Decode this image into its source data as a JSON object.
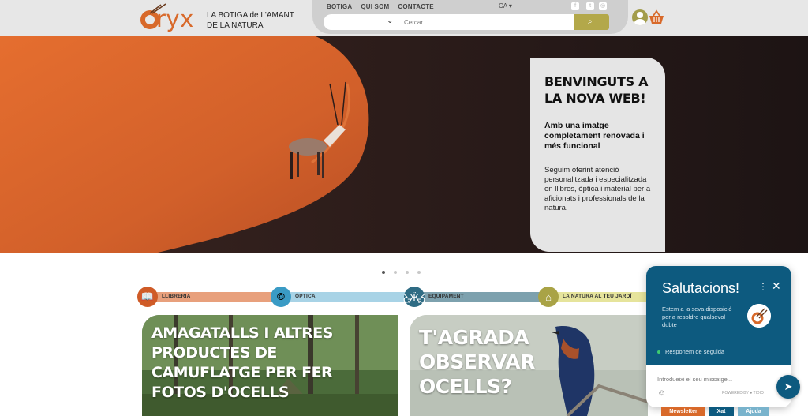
{
  "brand": {
    "logo_text": "ryx",
    "tagline": "LA BOTIGA de L'AMANT DE LA NATURA"
  },
  "nav": {
    "links": [
      "BOTIGA",
      "QUI SOM",
      "CONTACTE"
    ],
    "language": "CA",
    "social_icons": [
      "facebook-icon",
      "twitter-icon",
      "instagram-icon"
    ]
  },
  "search": {
    "placeholder": "Cercar"
  },
  "hero": {
    "title": "BENVINGUTS A LA NOVA WEB!",
    "subtitle": "Amb una imatge completament renovada i més funcional",
    "body": "Seguim oferint atenció personalitzada i especialitzada en llibres, òptica i material per a aficionats i professionals de la natura.",
    "slides": 4,
    "active_slide": 1
  },
  "categories": [
    {
      "label": "LLIBRERIA",
      "color": "#e8a07c",
      "circle": "#cf5b27"
    },
    {
      "label": "ÒPTICA",
      "color": "#a8d3e6",
      "circle": "#3a9bc5"
    },
    {
      "label": "EQUIPAMENT",
      "color": "#7da1ae",
      "circle": "#2f6c84"
    },
    {
      "label": "LA NATURA AL TEU JARDÍ",
      "color": "#e6e49c",
      "circle": "#a9a346"
    }
  ],
  "tiles": [
    {
      "title": "AMAGATALLS I ALTRES PRODUCTES DE CAMUFLATGE PER FER FOTOS D'OCELLS"
    },
    {
      "title": "T'AGRADA OBSERVAR OCELLS?"
    }
  ],
  "chat": {
    "title": "Salutacions!",
    "description": "Estem a la seva disposició per a resoldre qualsevol dubte",
    "status": "Responem de seguida",
    "input_placeholder": "Introdueixi el seu missatge...",
    "powered_by": "POWERED BY ● TIDIO"
  },
  "bottom_buttons": [
    "Newsletter",
    "Xat",
    "Ajuda"
  ]
}
